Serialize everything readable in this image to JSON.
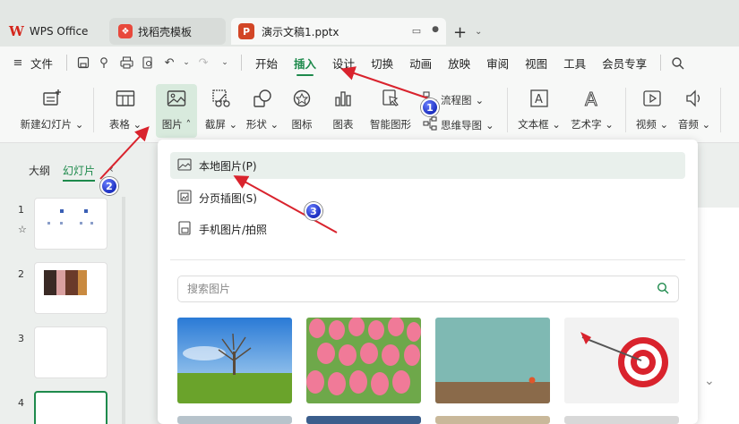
{
  "tabs": [
    {
      "label": "WPS Office",
      "icon": "wps-logo"
    },
    {
      "label": "找稻壳模板",
      "icon": "docer-logo"
    },
    {
      "label": "演示文稿1.pptx",
      "icon": "ppt-logo"
    }
  ],
  "menubar": {
    "file": "文件",
    "items": [
      "开始",
      "插入",
      "设计",
      "切换",
      "动画",
      "放映",
      "审阅",
      "视图",
      "工具",
      "会员专享"
    ],
    "active": "插入"
  },
  "ribbon": {
    "new_slide": "新建幻灯片",
    "table": "表格",
    "picture": "图片",
    "screenshot": "截屏",
    "shape": "形状",
    "icon": "图标",
    "chart": "图表",
    "smart": "智能图形",
    "flowchart": "流程图",
    "mindmap": "思维导图",
    "textbox": "文本框",
    "wordart": "艺术字",
    "video": "视频",
    "audio": "音频"
  },
  "panel": {
    "outline": "大纲",
    "slides": "幻灯片",
    "nums": [
      "1",
      "2",
      "3",
      "4"
    ]
  },
  "dropdown": {
    "local": "本地图片(P)",
    "split": "分页插图(S)",
    "phone": "手机图片/拍照",
    "search_placeholder": "搜索图片"
  },
  "annotations": [
    "1",
    "2",
    "3"
  ],
  "colors": {
    "accent": "#1e8a4c",
    "arrow": "#d9232d"
  }
}
